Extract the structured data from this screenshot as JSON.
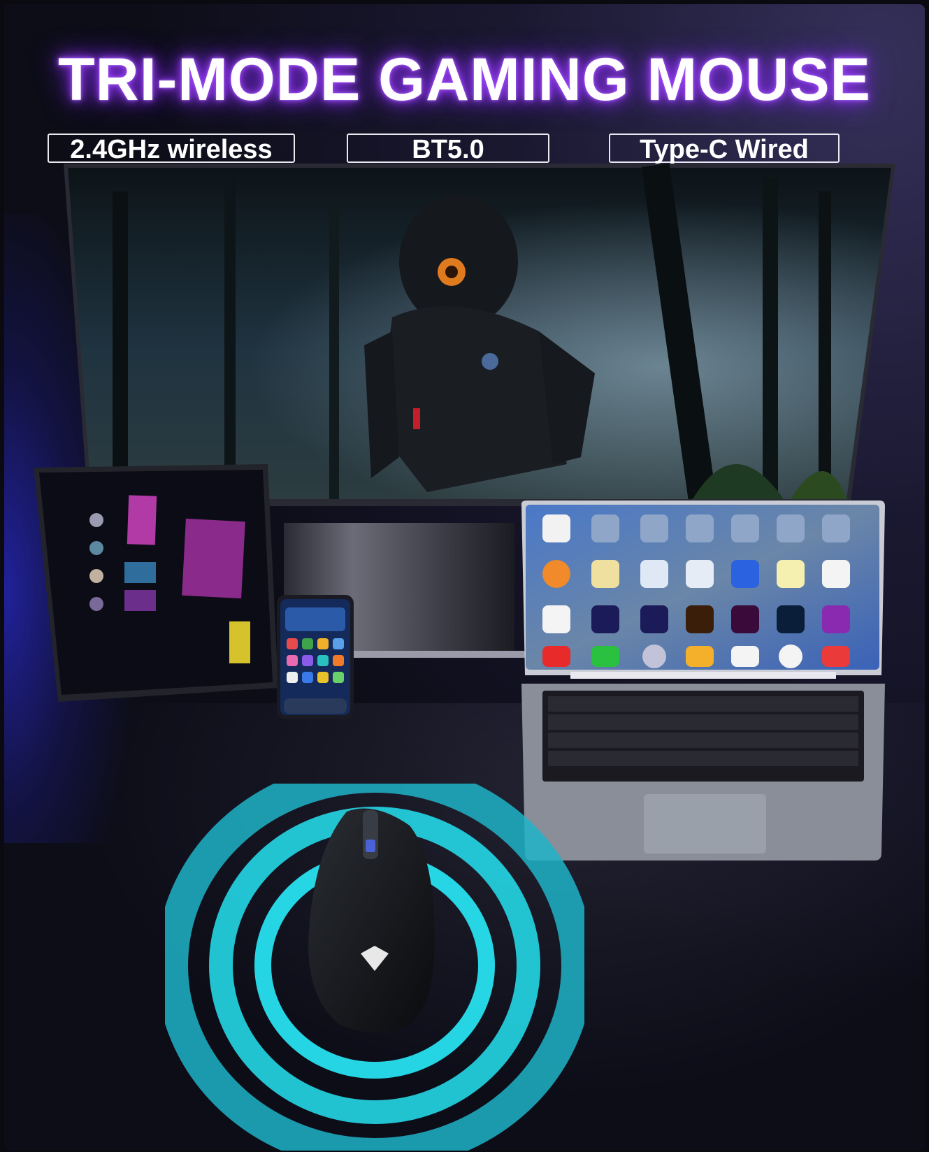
{
  "headline": "TRI-MODE GAMING MOUSE",
  "modes": [
    {
      "label": "2.4GHz wireless"
    },
    {
      "label": "BT5.0"
    },
    {
      "label": "Type-C Wired"
    }
  ],
  "colors": {
    "title_glow": "#8a2be2",
    "ring_cyan": "#25d7e6",
    "side_glow": "#2a2ad0"
  },
  "icons": {
    "monitor": "monitor-icon",
    "tablet": "tablet-icon",
    "phone": "smartphone-icon",
    "laptop": "laptop-icon",
    "mouse": "gaming-mouse-icon",
    "signal": "wireless-signal-icon"
  }
}
